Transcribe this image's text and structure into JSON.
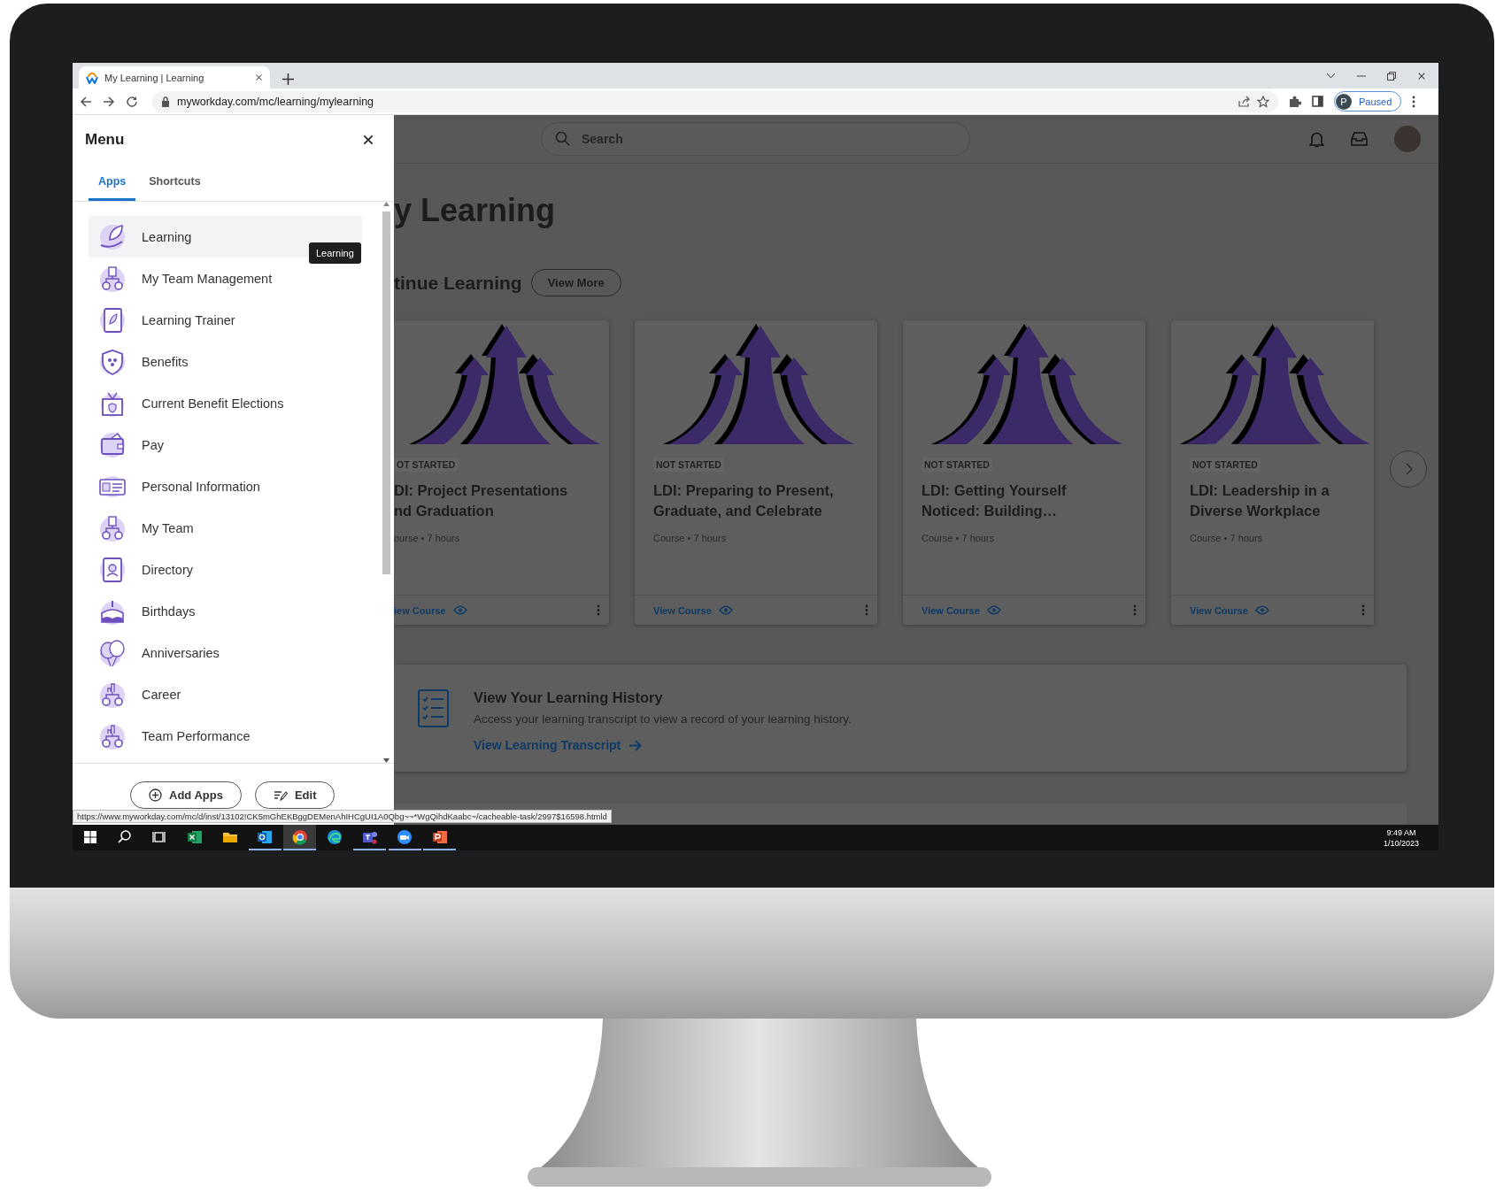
{
  "browser": {
    "tab_title": "My Learning | Learning",
    "url": "myworkday.com/mc/learning/mylearning",
    "profile_initial": "P",
    "profile_status": "Paused"
  },
  "menu": {
    "title": "Menu",
    "tabs": [
      {
        "label": "Apps",
        "selected": true
      },
      {
        "label": "Shortcuts",
        "selected": false
      }
    ],
    "items": [
      {
        "label": "Learning",
        "selected": true
      },
      {
        "label": "My Team Management",
        "selected": false
      },
      {
        "label": "Learning Trainer",
        "selected": false
      },
      {
        "label": "Benefits",
        "selected": false
      },
      {
        "label": "Current Benefit Elections",
        "selected": false
      },
      {
        "label": "Pay",
        "selected": false
      },
      {
        "label": "Personal Information",
        "selected": false
      },
      {
        "label": "My Team",
        "selected": false
      },
      {
        "label": "Directory",
        "selected": false
      },
      {
        "label": "Birthdays",
        "selected": false
      },
      {
        "label": "Anniversaries",
        "selected": false
      },
      {
        "label": "Career",
        "selected": false
      },
      {
        "label": "Team Performance",
        "selected": false
      }
    ],
    "tooltip": "Learning",
    "buttons": [
      {
        "label": "Add Apps"
      },
      {
        "label": "Edit"
      }
    ]
  },
  "header": {
    "search": {
      "placeholder": "Search"
    }
  },
  "page": {
    "title": "y Learning",
    "section_title": "tinue Learning",
    "view_more": "View More"
  },
  "cards": [
    {
      "status": "OT STARTED",
      "title_lines": [
        "DI: Project Presentations",
        "nd Graduation"
      ],
      "meta_type": "ourse",
      "meta_separator": "•",
      "meta_duration": "7 hours",
      "action": "iew Course"
    },
    {
      "status": "NOT STARTED",
      "title_lines": [
        "LDI: Preparing to Present,",
        "Graduate, and Celebrate"
      ],
      "meta_type": "Course",
      "meta_separator": "•",
      "meta_duration": "7 hours",
      "action": "View Course"
    },
    {
      "status": "NOT STARTED",
      "title_lines": [
        "LDI: Getting Yourself",
        "Noticed: Building…"
      ],
      "meta_type": "Course",
      "meta_separator": "•",
      "meta_duration": "7 hours",
      "action": "View Course"
    },
    {
      "status": "NOT STARTED",
      "title_lines": [
        "LDI: Leadership in a",
        "Diverse Workplace"
      ],
      "meta_type": "Course",
      "meta_separator": "•",
      "meta_duration": "7 hours",
      "action": "View Course"
    }
  ],
  "history": {
    "title": "View Your Learning History",
    "description": "Access your learning transcript to view a record of your learning history.",
    "link": "View Learning Transcript"
  },
  "status_url": "https://www.myworkday.com/mc/d/inst/13102!CK5mGhEKBggDEMenAhIHCgUI1A0Qbg~~*WgQihdKaabc~/cacheable-task/2997$16598.htmld",
  "taskbar": {
    "apps": [
      {
        "running": false,
        "selected": false
      },
      {
        "running": false,
        "selected": false
      },
      {
        "running": false,
        "selected": false
      },
      {
        "running": false,
        "selected": false
      },
      {
        "running": false,
        "selected": false
      },
      {
        "running": true,
        "selected": false
      },
      {
        "running": true,
        "selected": true
      },
      {
        "running": false,
        "selected": false
      },
      {
        "running": true,
        "selected": false
      },
      {
        "running": true,
        "selected": false
      },
      {
        "running": true,
        "selected": false
      }
    ],
    "time": "9:49 AM",
    "date": "1/10/2023"
  }
}
